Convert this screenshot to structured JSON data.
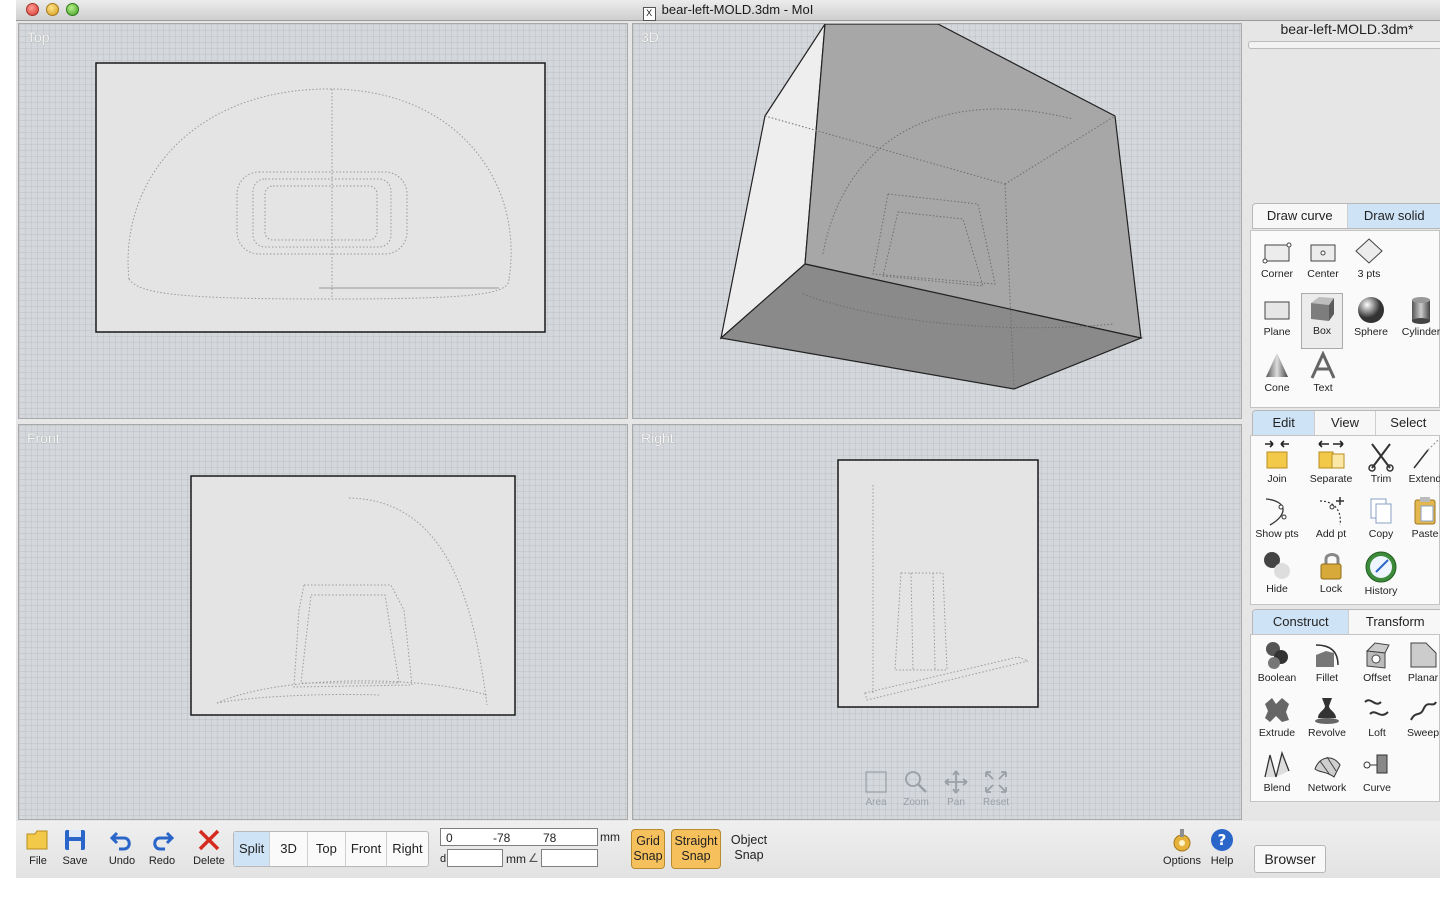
{
  "window": {
    "title": "bear-left-MOLD.3dm - MoI"
  },
  "viewports": {
    "top": {
      "label": "Top"
    },
    "threeD": {
      "label": "3D"
    },
    "front": {
      "label": "Front"
    },
    "right": {
      "label": "Right"
    }
  },
  "nav": {
    "area": "Area",
    "zoom": "Zoom",
    "pan": "Pan",
    "reset": "Reset"
  },
  "toolbar": {
    "file": "File",
    "save": "Save",
    "undo": "Undo",
    "redo": "Redo",
    "delete": "Delete",
    "views": [
      "Split",
      "3D",
      "Top",
      "Front",
      "Right"
    ],
    "coords": {
      "x": "0",
      "y": "-78",
      "z": "78",
      "unit": "mm",
      "d_label": "d",
      "d_value": "",
      "angle_value": "",
      "d_unit": "mm"
    },
    "grid_snap": [
      "Grid",
      "Snap"
    ],
    "straight_snap": [
      "Straight",
      "Snap"
    ],
    "object_snap": [
      "Object",
      "Snap"
    ],
    "options": "Options",
    "help": "Help",
    "browser": "Browser"
  },
  "sidebar": {
    "file_title": "bear-left-MOLD.3dm*",
    "draw_tabs": [
      "Draw curve",
      "Draw solid"
    ],
    "draw_tools": [
      "Corner",
      "Center",
      "3 pts",
      "Plane",
      "Box",
      "Sphere",
      "Cylinder",
      "Cone",
      "Text"
    ],
    "edit_tabs": [
      "Edit",
      "View",
      "Select"
    ],
    "edit_tools": [
      "Join",
      "Separate",
      "Trim",
      "Extend",
      "Show pts",
      "Add pt",
      "Copy",
      "Paste",
      "Hide",
      "Lock",
      "History"
    ],
    "construct_tabs": [
      "Construct",
      "Transform"
    ],
    "construct_tools": [
      "Boolean",
      "Fillet",
      "Offset",
      "Planar",
      "Extrude",
      "Revolve",
      "Loft",
      "Sweep",
      "Blend",
      "Network",
      "Curve"
    ]
  },
  "colors": {
    "active_tab": "#cfe3f6",
    "snap_on": "#f6c05c",
    "viewport_bg": "#d4d7db",
    "icon_blue": "#2a66c9"
  }
}
